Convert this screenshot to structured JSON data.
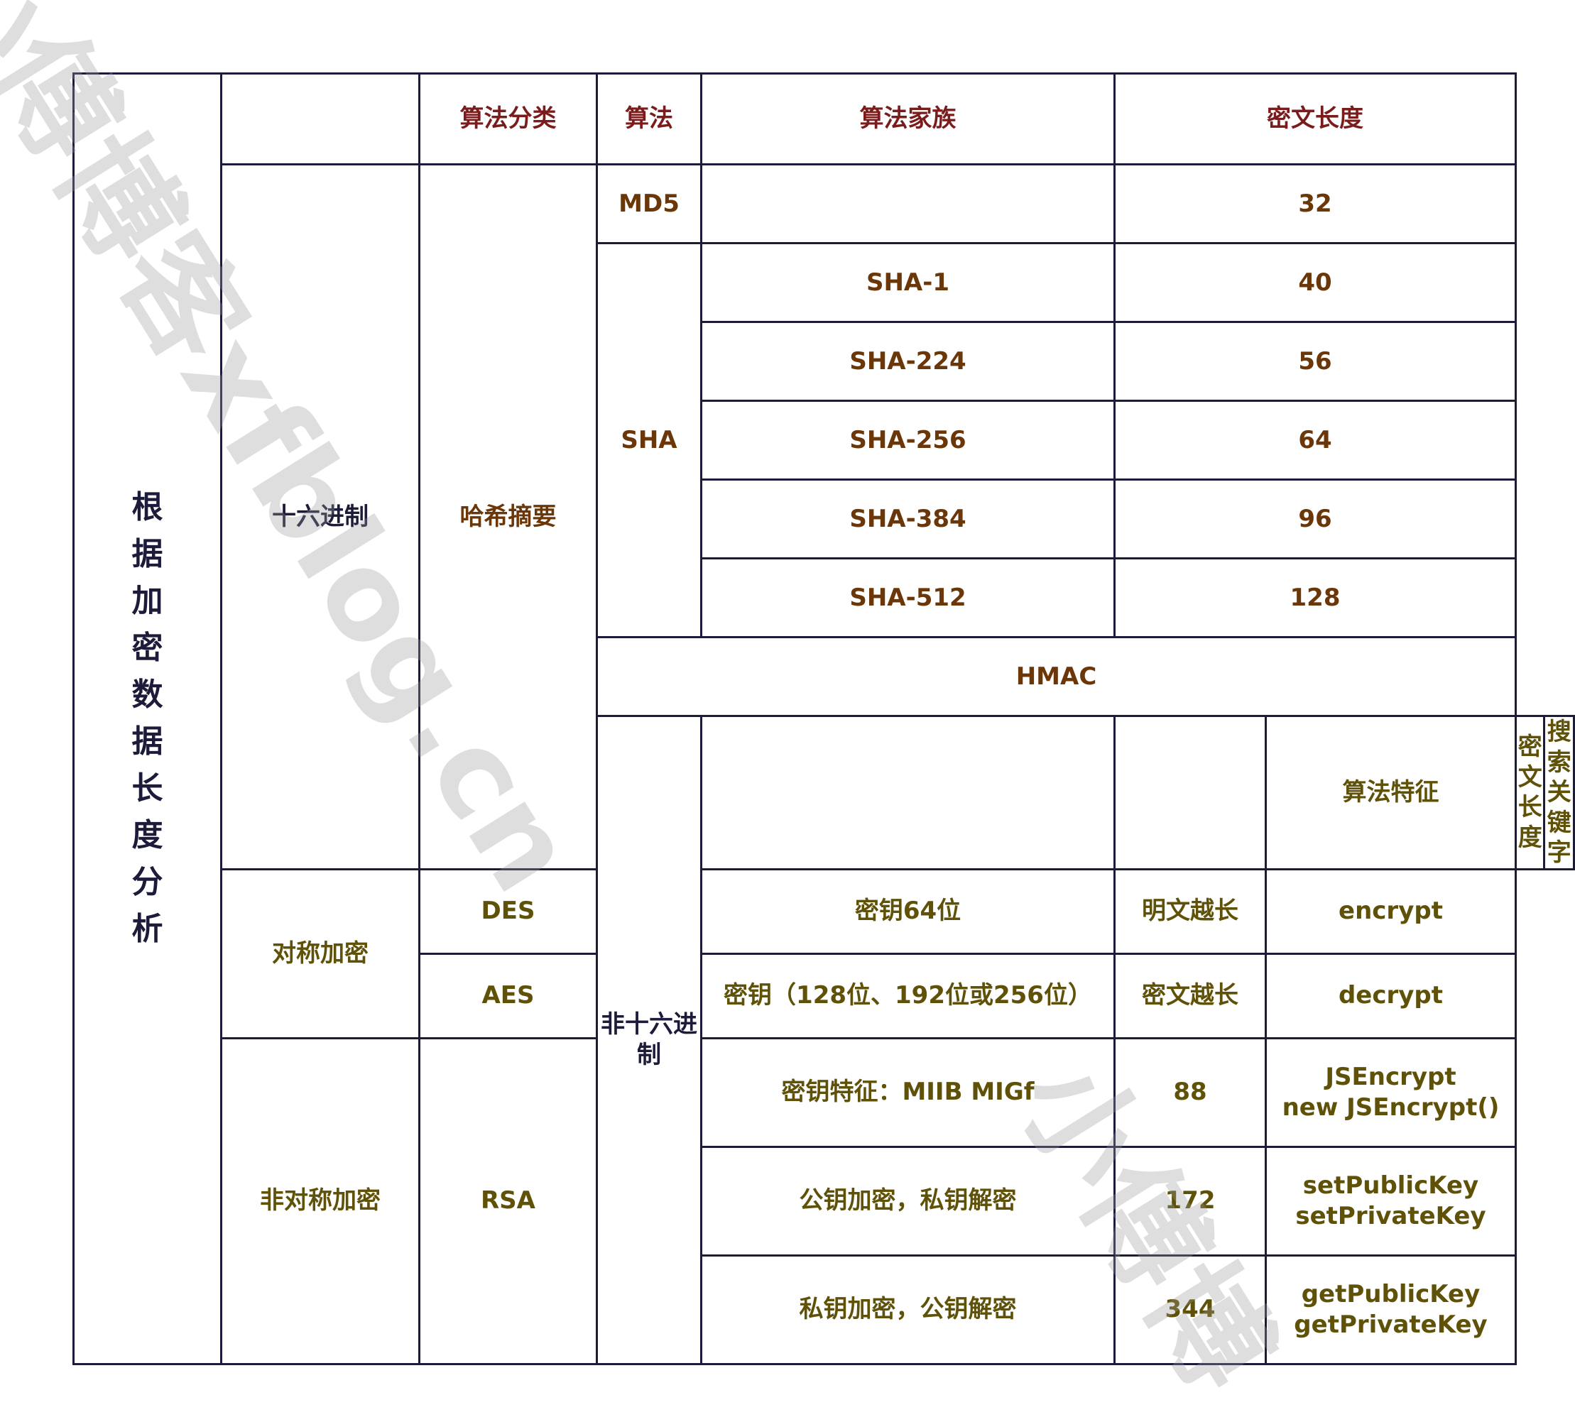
{
  "watermark": {
    "text_1": "小傅博客xfblog.cn",
    "text_2": "小傅博"
  },
  "title_chars": [
    "根",
    "据",
    "加",
    "密",
    "数",
    "据",
    "长",
    "度",
    "分",
    "析"
  ],
  "header": {
    "category": "算法分类",
    "algorithm": "算法",
    "family": "算法家族",
    "length": "密文长度"
  },
  "hex": {
    "label": "十六进制",
    "category": "哈希摘要",
    "md5": {
      "name": "MD5",
      "family": "",
      "length": "32"
    },
    "sha": {
      "name": "SHA",
      "rows": [
        {
          "family": "SHA-1",
          "length": "40"
        },
        {
          "family": "SHA-224",
          "length": "56"
        },
        {
          "family": "SHA-256",
          "length": "64"
        },
        {
          "family": "SHA-384",
          "length": "96"
        },
        {
          "family": "SHA-512",
          "length": "128"
        }
      ]
    },
    "hmac": "HMAC"
  },
  "nonhex": {
    "label": "非十六进制",
    "header": {
      "feature": "算法特征",
      "length": "密文长度",
      "keyword": "搜索关键字"
    },
    "symmetric": {
      "category": "对称加密",
      "des": {
        "name": "DES",
        "feature": "密钥64位",
        "length": "明文越长",
        "keyword": "encrypt"
      },
      "aes": {
        "name": "AES",
        "feature": "密钥（128位、192位或256位）",
        "length": "密文越长",
        "keyword": "decrypt"
      }
    },
    "asymmetric": {
      "category": "非对称加密",
      "name": "RSA",
      "rows": [
        {
          "feature": "密钥特征：MIIB MIGf",
          "length": "88",
          "keyword_1": "JSEncrypt",
          "keyword_2": "new JSEncrypt()"
        },
        {
          "feature": "公钥加密，私钥解密",
          "length": "172",
          "keyword_1": "setPublicKey",
          "keyword_2": "setPrivateKey"
        },
        {
          "feature": "私钥加密，公钥解密",
          "length": "344",
          "keyword_1": "getPublicKey",
          "keyword_2": "getPrivateKey"
        }
      ]
    }
  }
}
